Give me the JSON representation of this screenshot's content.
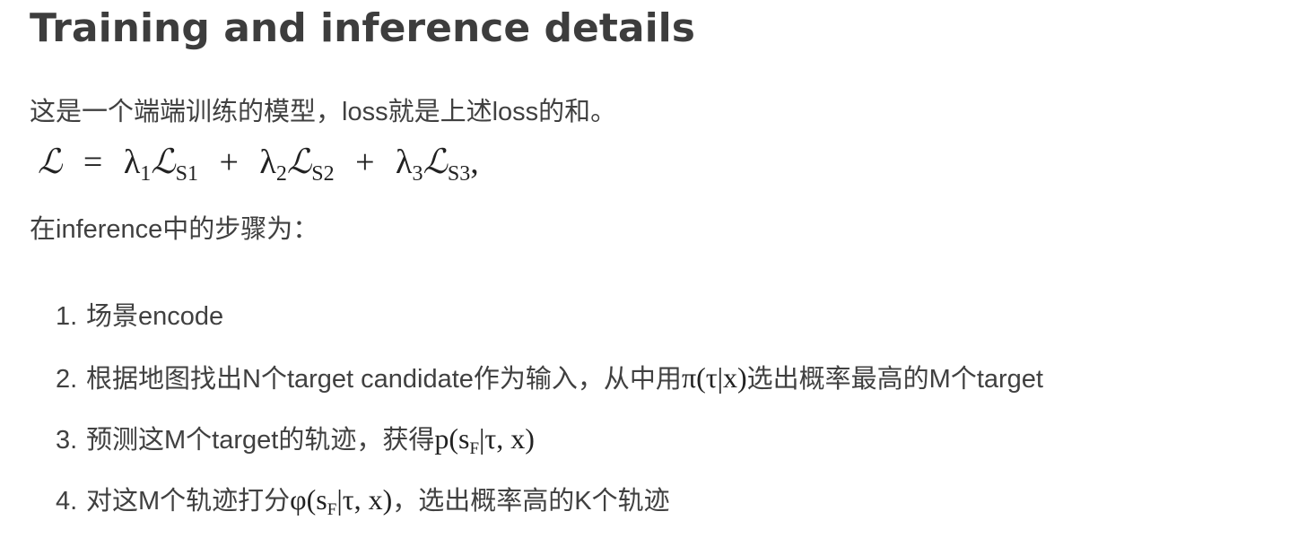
{
  "heading": "Training and inference details",
  "intro": "这是一个端端训练的模型，loss就是上述loss的和。",
  "formula": {
    "lhs": "ℒ",
    "eq": "=",
    "terms": [
      {
        "coef": "λ",
        "coef_sub": "1",
        "sym": "ℒ",
        "sub": "S1"
      },
      {
        "coef": "λ",
        "coef_sub": "2",
        "sym": "ℒ",
        "sub": "S2"
      },
      {
        "coef": "λ",
        "coef_sub": "3",
        "sym": "ℒ",
        "sub": "S3"
      }
    ],
    "plus": "+",
    "tail": ","
  },
  "inference_intro": "在inference中的步骤为：",
  "steps": [
    {
      "num": "1.",
      "text": "场景encode"
    },
    {
      "num": "2.",
      "text_before": "根据地图找出N个target candidate作为输入，从中用",
      "math": "π(τ|x)",
      "text_after": "选出概率最高的M个target"
    },
    {
      "num": "3.",
      "text_before": "预测这M个target的轨迹，获得",
      "math_pre": "p(s",
      "math_sub": "F",
      "math_post": "|τ, x)"
    },
    {
      "num": "4.",
      "text_before": "对这M个轨迹打分",
      "math_pre": "φ(s",
      "math_sub": "F",
      "math_post": "|τ, x)",
      "text_after": "，选出概率高的K个轨迹"
    }
  ]
}
